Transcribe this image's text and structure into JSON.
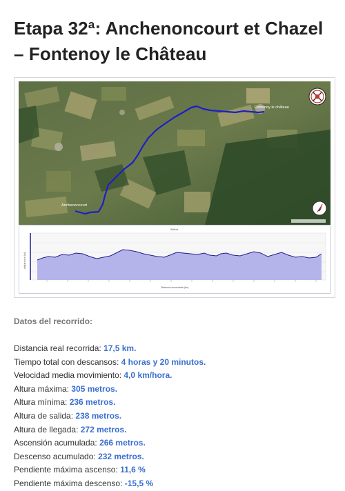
{
  "page": {
    "title_line1": "Etapa 32ª: Anchenoncourt et Chazel",
    "title_line2": "– Fontenoy le Château"
  },
  "map": {
    "start_label": "Anchenoncourt",
    "end_label": "Fontenoy le château",
    "route_color": "#1e1ec8",
    "logo_icon": "pilgrim-badge-icon",
    "compass_icon": "compass-icon"
  },
  "profile_chart": {
    "top_label": "Altitud",
    "y_label": "altitud en m [m]",
    "x_label": "Distancia acumulada (km)",
    "line_color": "#1e1e8c",
    "fill_color": "#b4b4eb"
  },
  "details": {
    "heading": "Datos del recorrido:",
    "rows": [
      {
        "label": "Distancia real recorrida: ",
        "value": "17,5 km."
      },
      {
        "label": "Tiempo total con descansos: ",
        "value": "4 horas y 20 minutos."
      },
      {
        "label": "Velocidad media movimiento: ",
        "value": "4,0 km/hora."
      },
      {
        "label": "Altura máxima: ",
        "value": "305 metros."
      },
      {
        "label": "Altura mínima: ",
        "value": "236 metros."
      },
      {
        "label": "Altura de salida: ",
        "value": "238 metros."
      },
      {
        "label": "Altura de llegada: ",
        "value": "272 metros."
      },
      {
        "label": "Ascensión acumulada: ",
        "value": "266 metros."
      },
      {
        "label": "Descenso acumulado: ",
        "value": "232 metros."
      },
      {
        "label": "Pendiente máxima ascenso: ",
        "value": "11,6 %"
      },
      {
        "label": "Pendiente máxima descenso: ",
        "value": "-15,5 %"
      }
    ],
    "accent_color": "#3a6ed0"
  }
}
